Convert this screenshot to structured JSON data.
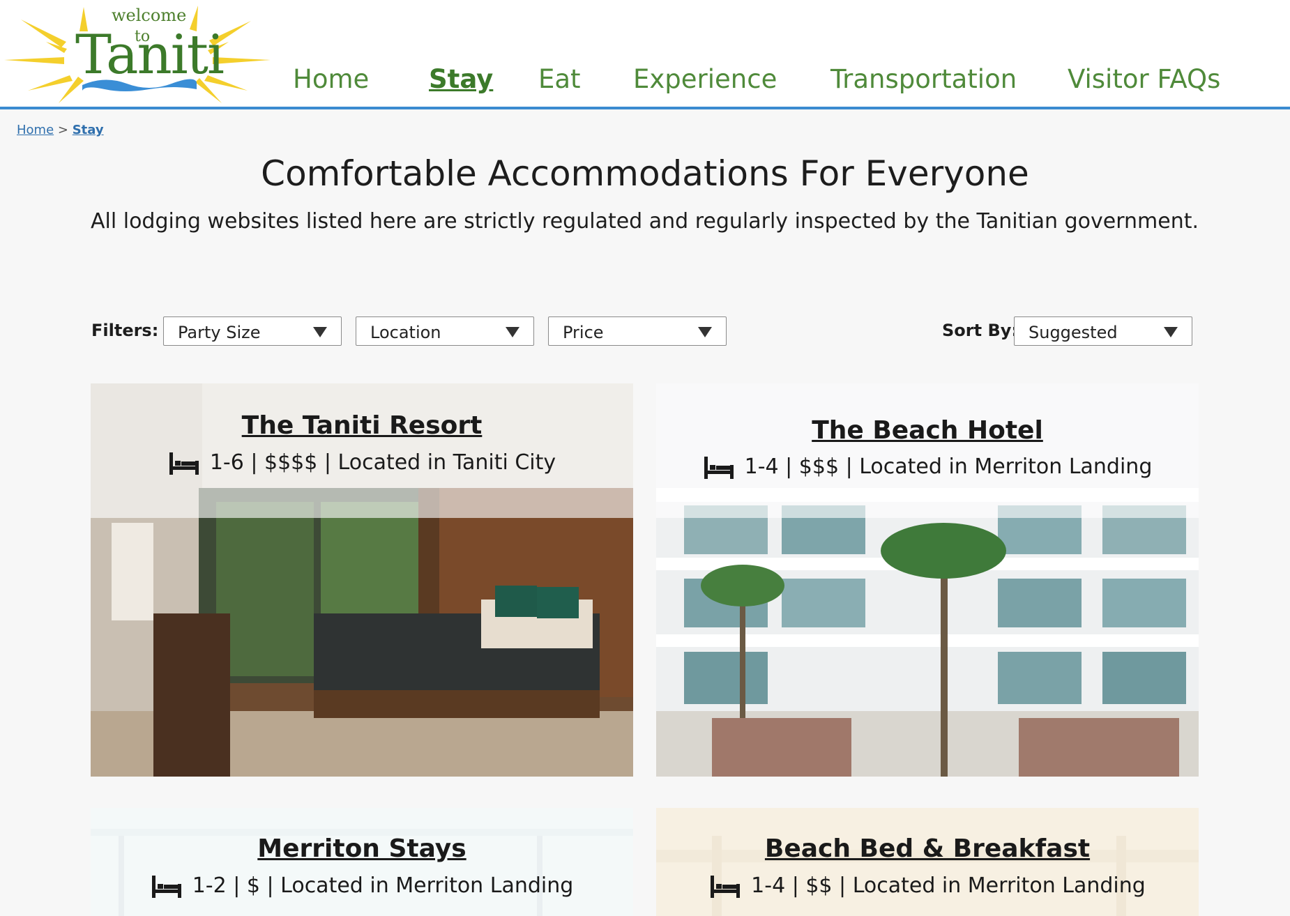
{
  "logo": {
    "welcome": "welcome",
    "to": "to",
    "name": "Taniti"
  },
  "nav": [
    {
      "label": "Home",
      "active": false
    },
    {
      "label": "Stay",
      "active": true
    },
    {
      "label": "Eat",
      "active": false
    },
    {
      "label": "Experience",
      "active": false
    },
    {
      "label": "Transportation",
      "active": false
    },
    {
      "label": "Visitor FAQs",
      "active": false
    }
  ],
  "breadcrumb": {
    "home": "Home",
    "separator": ">",
    "current": "Stay"
  },
  "page": {
    "title": "Comfortable Accommodations For Everyone",
    "subtitle": "All lodging websites listed here are strictly regulated and regularly inspected by the Tanitian government."
  },
  "filters": {
    "label": "Filters:",
    "party_size": "Party Size",
    "location": "Location",
    "price": "Price"
  },
  "sort": {
    "label": "Sort By:",
    "value": "Suggested"
  },
  "listings": [
    {
      "name": "The Taniti Resort",
      "details": "1-6 | $$$$ | Located in Taniti City"
    },
    {
      "name": "The Beach Hotel",
      "details": "1-4 | $$$ | Located in Merriton Landing"
    },
    {
      "name": "Merriton Stays",
      "details": "1-2 | $ | Located in Merriton Landing"
    },
    {
      "name": "Beach Bed & Breakfast",
      "details": "1-4 | $$ | Located in Merriton Landing"
    }
  ],
  "colors": {
    "accent_blue": "#3b8bd0",
    "nav_green": "#4f8a3a",
    "logo_green": "#3c7a2a",
    "sun_yellow": "#f4cf2c",
    "link_blue": "#2f6fad"
  },
  "icons": {
    "bed": "bed-icon",
    "dropdown": "chevron-down-icon",
    "sun": "sun-icon"
  }
}
